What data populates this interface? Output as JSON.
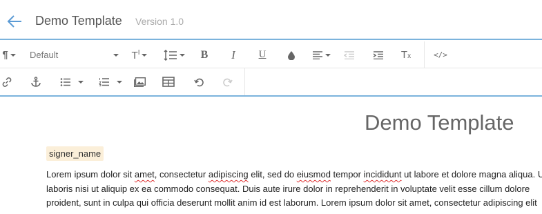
{
  "header": {
    "title": "Demo Template",
    "version": "Version 1.0"
  },
  "toolbar": {
    "font_family": "Default",
    "icons": [
      "paragraph-icon",
      "text-size-icon",
      "line-height-icon",
      "bold-icon",
      "italic-icon",
      "underline-icon",
      "text-color-icon",
      "align-icon",
      "outdent-icon",
      "indent-icon",
      "clear-format-icon",
      "code-view-icon",
      "link-icon",
      "anchor-icon",
      "bullet-list-icon",
      "numbered-list-icon",
      "image-icon",
      "table-icon",
      "undo-icon",
      "redo-icon"
    ]
  },
  "document": {
    "title": "Demo Template",
    "tag": "signer_name",
    "line1": {
      "a": "Lorem ipsum dolor sit ",
      "b": "amet",
      "c": ", consectetur ",
      "d": "adipiscing",
      "e": " elit, sed do ",
      "f": "eiusmod",
      "g": " tempor ",
      "h": "incididunt",
      "i": " ut labore et dolore magna aliqua. Ut"
    },
    "line2": "laboris nisi ut aliquip ex ea commodo consequat. Duis aute irure dolor in reprehenderit in voluptate velit esse cillum dolore",
    "line3": "proident, sunt in culpa qui officia deserunt mollit anim id est laborum. Lorem ipsum dolor sit amet, consectetur adipiscing elit"
  },
  "colors": {
    "accent": "#7bb3dc",
    "tag_bg": "#fbefd9",
    "spell_underline": "#d33"
  }
}
